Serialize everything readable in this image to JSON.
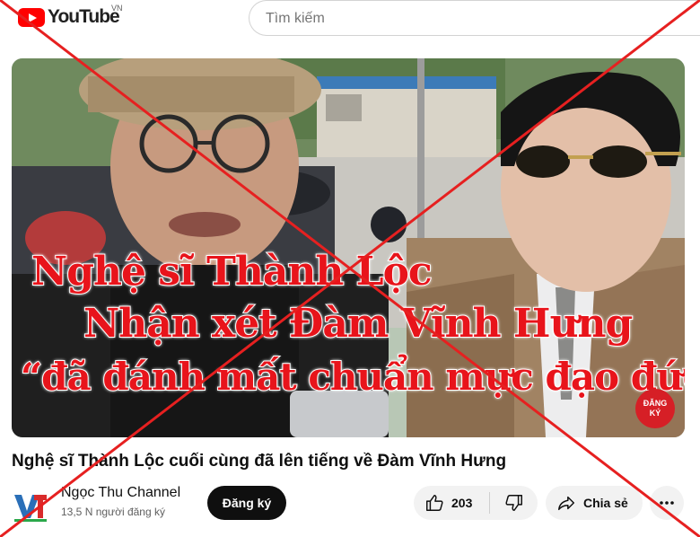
{
  "header": {
    "logo_text": "YouTube",
    "country_code": "VN",
    "search_placeholder": "Tìm kiếm"
  },
  "thumbnail": {
    "overlay_line1": "Nghệ sĩ Thành Lộc",
    "overlay_line2": "Nhận xét Đàm Vĩnh Hưng",
    "overlay_line3": "“đã đánh mất chuẩn mực đạo đức”",
    "badge_text_1": "ĐĂNG",
    "badge_text_2": "KÝ"
  },
  "video": {
    "title": "Nghệ sĩ Thành Lộc cuối cùng đã lên tiếng về Đàm Vĩnh Hưng"
  },
  "channel": {
    "name": "Ngọc Thu Channel",
    "subscribers": "13,5 N người đăng ký",
    "subscribe_label": "Đăng ký"
  },
  "actions": {
    "like_count": "203",
    "share_label": "Chia sẻ"
  },
  "icons": [
    "youtube-logo-icon",
    "like-icon",
    "dislike-icon",
    "share-icon",
    "more-icon"
  ],
  "colors": {
    "brand_red": "#ff0000",
    "cross_red": "#e62020",
    "overlay_text_red": "#e8141b"
  }
}
